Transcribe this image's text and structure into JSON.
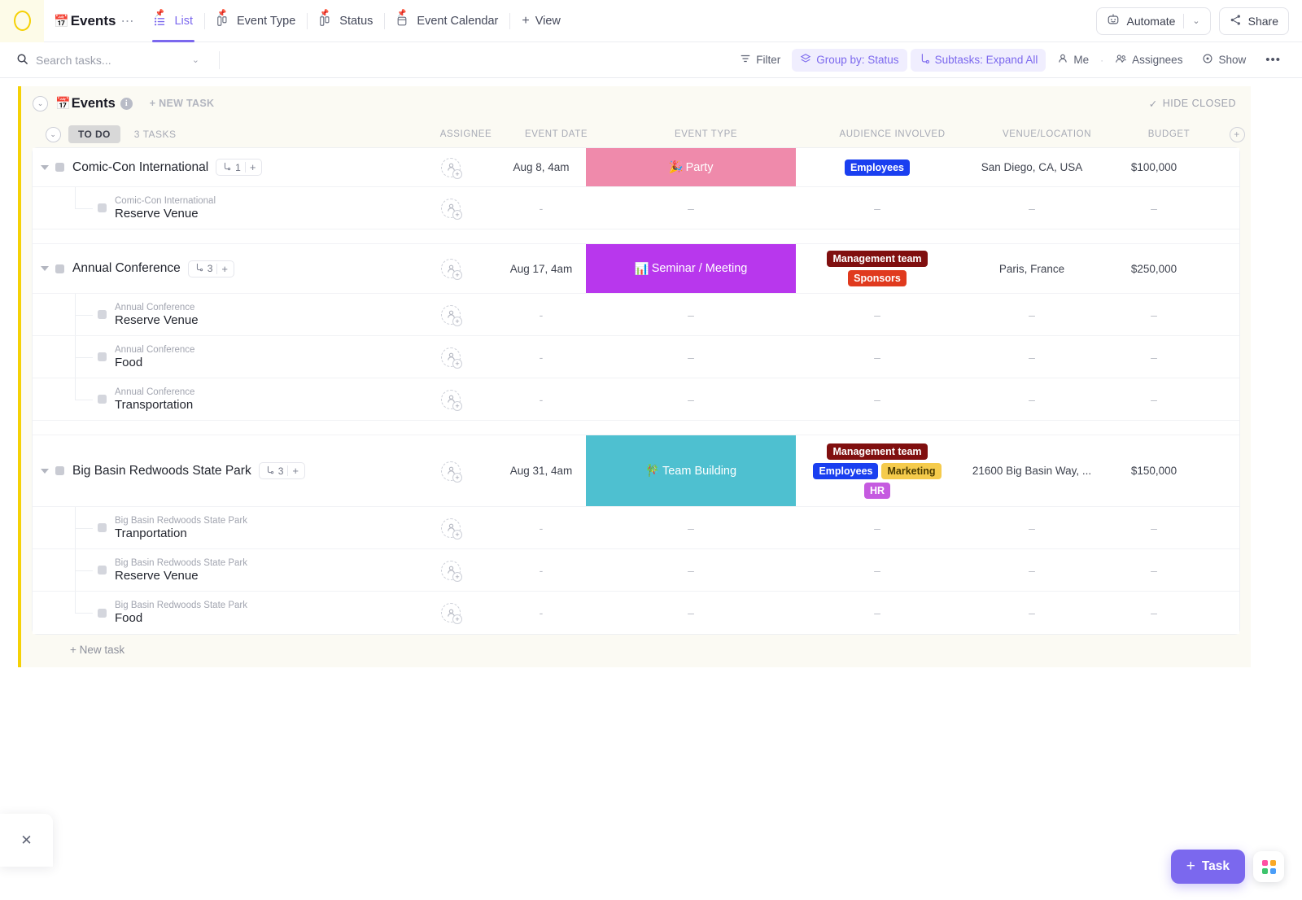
{
  "topbar": {
    "space_name": "Events",
    "space_emoji": "📅",
    "overflow_dots": "⋯",
    "tabs": [
      {
        "label": "List",
        "icon": "list-icon",
        "active": true
      },
      {
        "label": "Event Type",
        "icon": "board-icon",
        "active": false
      },
      {
        "label": "Status",
        "icon": "board-icon",
        "active": false
      },
      {
        "label": "Event Calendar",
        "icon": "calendar-icon",
        "active": false
      }
    ],
    "add_view_label": "View",
    "automate_label": "Automate",
    "share_label": "Share"
  },
  "filterbar": {
    "search_placeholder": "Search tasks...",
    "filter_label": "Filter",
    "group_by_label": "Group by: Status",
    "subtasks_label": "Subtasks: Expand All",
    "me_label": "Me",
    "assignees_label": "Assignees",
    "show_label": "Show",
    "more_label": "•••"
  },
  "list": {
    "emoji": "📅",
    "name": "Events",
    "new_task_label": "+ NEW TASK",
    "hide_closed_label": "HIDE CLOSED",
    "group_status": "TO DO",
    "task_count_label": "3 TASKS",
    "new_task_bottom": "+ New task",
    "columns": [
      "ASSIGNEE",
      "EVENT DATE",
      "EVENT TYPE",
      "AUDIENCE INVOLVED",
      "VENUE/LOCATION",
      "BUDGET"
    ],
    "empty_value": "-",
    "empty_value_dash": "–"
  },
  "colors": {
    "accent": "#7b68ee",
    "list_bar": "#f5d106",
    "party": "#ef8aab",
    "seminar": "#b837ed",
    "team_building": "#4ec0d0",
    "tag_employees": "#1a3ff0",
    "tag_management": "#800f0f",
    "tag_sponsors": "#e03a1e",
    "tag_marketing": "#f5cb4c",
    "tag_hr": "#c55ae0"
  },
  "tasks": [
    {
      "name": "Comic-Con International",
      "subtask_count": "1",
      "date": "Aug 8, 4am",
      "type": {
        "label": "Party",
        "emoji": "🎉",
        "color": "#ef8aab"
      },
      "audience": [
        {
          "label": "Employees",
          "color": "#1a3ff0"
        }
      ],
      "venue": "San Diego, CA, USA",
      "budget": "$100,000",
      "subtasks": [
        {
          "parent": "Comic-Con International",
          "name": "Reserve Venue"
        }
      ]
    },
    {
      "name": "Annual Conference",
      "subtask_count": "3",
      "date": "Aug 17, 4am",
      "type": {
        "label": "Seminar / Meeting",
        "emoji": "📊",
        "color": "#b837ed"
      },
      "audience": [
        {
          "label": "Management team",
          "color": "#800f0f"
        },
        {
          "label": "Sponsors",
          "color": "#e03a1e"
        }
      ],
      "venue": "Paris, France",
      "budget": "$250,000",
      "subtasks": [
        {
          "parent": "Annual Conference",
          "name": "Reserve Venue"
        },
        {
          "parent": "Annual Conference",
          "name": "Food"
        },
        {
          "parent": "Annual Conference",
          "name": "Transportation"
        }
      ]
    },
    {
      "name": "Big Basin Redwoods State Park",
      "subtask_count": "3",
      "date": "Aug 31, 4am",
      "type": {
        "label": "Team Building",
        "emoji": "🎋",
        "color": "#4ec0d0"
      },
      "audience": [
        {
          "label": "Management team",
          "color": "#800f0f"
        },
        {
          "label": "Employees",
          "color": "#1a3ff0"
        },
        {
          "label": "Marketing",
          "color": "#f5cb4c",
          "text_color": "#4a3a00"
        },
        {
          "label": "HR",
          "color": "#c55ae0"
        }
      ],
      "venue": "21600 Big Basin Way, ...",
      "budget": "$150,000",
      "subtasks": [
        {
          "parent": "Big Basin Redwoods State Park",
          "name": "Tranportation"
        },
        {
          "parent": "Big Basin Redwoods State Park",
          "name": "Reserve Venue"
        },
        {
          "parent": "Big Basin Redwoods State Park",
          "name": "Food"
        }
      ]
    }
  ],
  "fab": {
    "task_label": "Task",
    "plus": "+"
  }
}
